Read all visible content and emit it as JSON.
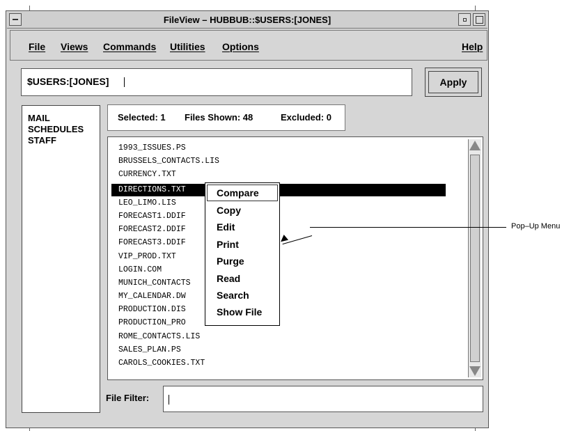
{
  "window": {
    "title": "FileView – HUBBUB::$USERS:[JONES]"
  },
  "menubar": {
    "file": "File",
    "views": "Views",
    "commands": "Commands",
    "utilities": "Utilities",
    "options": "Options",
    "help": "Help"
  },
  "path": {
    "value": "$USERS:[JONES]",
    "apply_label": "Apply"
  },
  "folders": [
    "MAIL",
    "SCHEDULES",
    "STAFF"
  ],
  "status": {
    "selected": "Selected: 1",
    "shown": "Files Shown: 48",
    "excluded": "Excluded: 0"
  },
  "files": [
    "1993_ISSUES.PS",
    "BRUSSELS_CONTACTS.LIS",
    "CURRENCY.TXT",
    "DIRECTIONS.TXT",
    "LEO_LIMO.LIS",
    "FORECAST1.DDIF",
    "FORECAST2.DDIF",
    "FORECAST3.DDIF",
    "VIP_PROD.TXT",
    "LOGIN.COM",
    "MUNICH_CONTACTS",
    "MY_CALENDAR.DW",
    "PRODUCTION.DIS",
    "PRODUCTION_PRO",
    "ROME_CONTACTS.LIS",
    "SALES_PLAN.PS",
    "CAROLS_COOKIES.TXT"
  ],
  "popup_menu": [
    "Compare",
    "Copy",
    "Edit",
    "Print",
    "Purge",
    "Read",
    "Search",
    "Show File"
  ],
  "filter": {
    "label": "File Filter:",
    "value": ""
  },
  "annotation": "Pop–Up Menu"
}
